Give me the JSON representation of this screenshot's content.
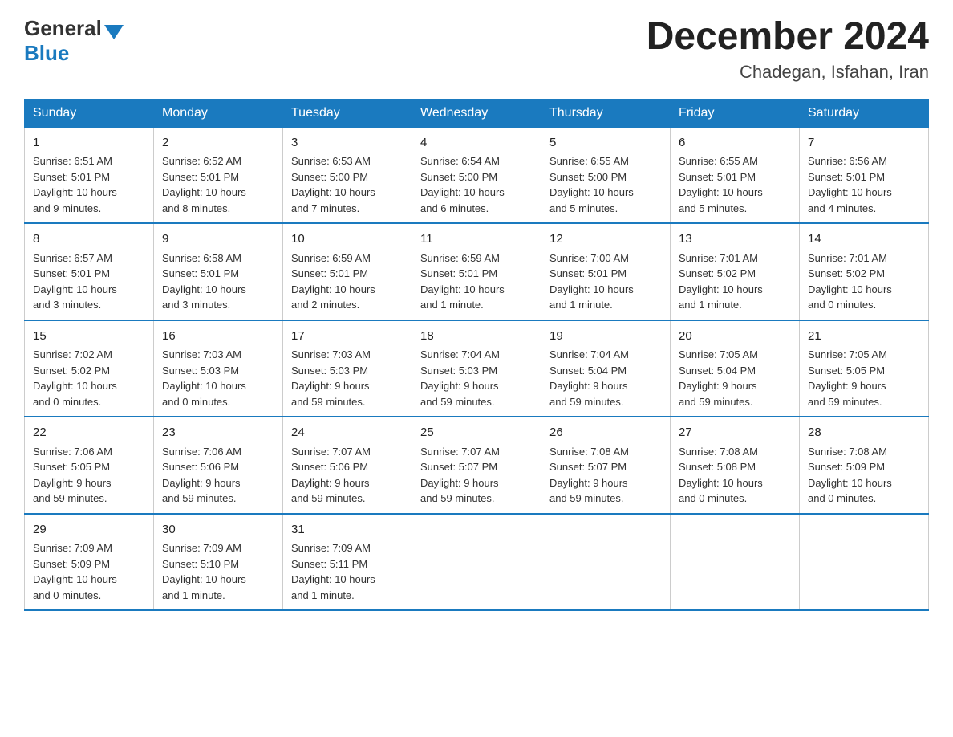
{
  "header": {
    "logo_general": "General",
    "logo_blue": "Blue",
    "month_title": "December 2024",
    "location": "Chadegan, Isfahan, Iran"
  },
  "days_of_week": [
    "Sunday",
    "Monday",
    "Tuesday",
    "Wednesday",
    "Thursday",
    "Friday",
    "Saturday"
  ],
  "weeks": [
    [
      {
        "num": "1",
        "info": "Sunrise: 6:51 AM\nSunset: 5:01 PM\nDaylight: 10 hours\nand 9 minutes."
      },
      {
        "num": "2",
        "info": "Sunrise: 6:52 AM\nSunset: 5:01 PM\nDaylight: 10 hours\nand 8 minutes."
      },
      {
        "num": "3",
        "info": "Sunrise: 6:53 AM\nSunset: 5:00 PM\nDaylight: 10 hours\nand 7 minutes."
      },
      {
        "num": "4",
        "info": "Sunrise: 6:54 AM\nSunset: 5:00 PM\nDaylight: 10 hours\nand 6 minutes."
      },
      {
        "num": "5",
        "info": "Sunrise: 6:55 AM\nSunset: 5:00 PM\nDaylight: 10 hours\nand 5 minutes."
      },
      {
        "num": "6",
        "info": "Sunrise: 6:55 AM\nSunset: 5:01 PM\nDaylight: 10 hours\nand 5 minutes."
      },
      {
        "num": "7",
        "info": "Sunrise: 6:56 AM\nSunset: 5:01 PM\nDaylight: 10 hours\nand 4 minutes."
      }
    ],
    [
      {
        "num": "8",
        "info": "Sunrise: 6:57 AM\nSunset: 5:01 PM\nDaylight: 10 hours\nand 3 minutes."
      },
      {
        "num": "9",
        "info": "Sunrise: 6:58 AM\nSunset: 5:01 PM\nDaylight: 10 hours\nand 3 minutes."
      },
      {
        "num": "10",
        "info": "Sunrise: 6:59 AM\nSunset: 5:01 PM\nDaylight: 10 hours\nand 2 minutes."
      },
      {
        "num": "11",
        "info": "Sunrise: 6:59 AM\nSunset: 5:01 PM\nDaylight: 10 hours\nand 1 minute."
      },
      {
        "num": "12",
        "info": "Sunrise: 7:00 AM\nSunset: 5:01 PM\nDaylight: 10 hours\nand 1 minute."
      },
      {
        "num": "13",
        "info": "Sunrise: 7:01 AM\nSunset: 5:02 PM\nDaylight: 10 hours\nand 1 minute."
      },
      {
        "num": "14",
        "info": "Sunrise: 7:01 AM\nSunset: 5:02 PM\nDaylight: 10 hours\nand 0 minutes."
      }
    ],
    [
      {
        "num": "15",
        "info": "Sunrise: 7:02 AM\nSunset: 5:02 PM\nDaylight: 10 hours\nand 0 minutes."
      },
      {
        "num": "16",
        "info": "Sunrise: 7:03 AM\nSunset: 5:03 PM\nDaylight: 10 hours\nand 0 minutes."
      },
      {
        "num": "17",
        "info": "Sunrise: 7:03 AM\nSunset: 5:03 PM\nDaylight: 9 hours\nand 59 minutes."
      },
      {
        "num": "18",
        "info": "Sunrise: 7:04 AM\nSunset: 5:03 PM\nDaylight: 9 hours\nand 59 minutes."
      },
      {
        "num": "19",
        "info": "Sunrise: 7:04 AM\nSunset: 5:04 PM\nDaylight: 9 hours\nand 59 minutes."
      },
      {
        "num": "20",
        "info": "Sunrise: 7:05 AM\nSunset: 5:04 PM\nDaylight: 9 hours\nand 59 minutes."
      },
      {
        "num": "21",
        "info": "Sunrise: 7:05 AM\nSunset: 5:05 PM\nDaylight: 9 hours\nand 59 minutes."
      }
    ],
    [
      {
        "num": "22",
        "info": "Sunrise: 7:06 AM\nSunset: 5:05 PM\nDaylight: 9 hours\nand 59 minutes."
      },
      {
        "num": "23",
        "info": "Sunrise: 7:06 AM\nSunset: 5:06 PM\nDaylight: 9 hours\nand 59 minutes."
      },
      {
        "num": "24",
        "info": "Sunrise: 7:07 AM\nSunset: 5:06 PM\nDaylight: 9 hours\nand 59 minutes."
      },
      {
        "num": "25",
        "info": "Sunrise: 7:07 AM\nSunset: 5:07 PM\nDaylight: 9 hours\nand 59 minutes."
      },
      {
        "num": "26",
        "info": "Sunrise: 7:08 AM\nSunset: 5:07 PM\nDaylight: 9 hours\nand 59 minutes."
      },
      {
        "num": "27",
        "info": "Sunrise: 7:08 AM\nSunset: 5:08 PM\nDaylight: 10 hours\nand 0 minutes."
      },
      {
        "num": "28",
        "info": "Sunrise: 7:08 AM\nSunset: 5:09 PM\nDaylight: 10 hours\nand 0 minutes."
      }
    ],
    [
      {
        "num": "29",
        "info": "Sunrise: 7:09 AM\nSunset: 5:09 PM\nDaylight: 10 hours\nand 0 minutes."
      },
      {
        "num": "30",
        "info": "Sunrise: 7:09 AM\nSunset: 5:10 PM\nDaylight: 10 hours\nand 1 minute."
      },
      {
        "num": "31",
        "info": "Sunrise: 7:09 AM\nSunset: 5:11 PM\nDaylight: 10 hours\nand 1 minute."
      },
      {
        "num": "",
        "info": ""
      },
      {
        "num": "",
        "info": ""
      },
      {
        "num": "",
        "info": ""
      },
      {
        "num": "",
        "info": ""
      }
    ]
  ]
}
